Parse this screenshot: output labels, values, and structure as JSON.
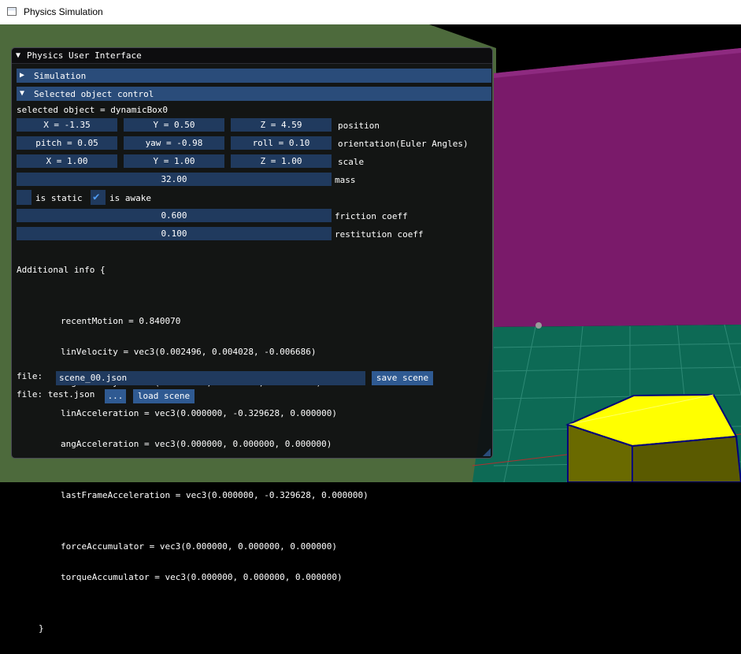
{
  "window": {
    "title": "Physics Simulation"
  },
  "panel": {
    "title": "Physics User Interface",
    "sections": {
      "simulation": "Simulation",
      "selected": "Selected object control"
    },
    "selected_object": "selected object = dynamicBox0",
    "position": {
      "x": "X = -1.35",
      "y": "Y = 0.50",
      "z": "Z = 4.59",
      "label": "position"
    },
    "orientation": {
      "pitch": "pitch = 0.05",
      "yaw": "yaw = -0.98",
      "roll": "roll = 0.10",
      "label": "orientation(Euler Angles)"
    },
    "scale": {
      "x": "X = 1.00",
      "y": "Y = 1.00",
      "z": "Z = 1.00",
      "label": "scale"
    },
    "mass": {
      "value": "32.00",
      "label": "mass"
    },
    "flags": {
      "is_static_label": "is static",
      "is_static": false,
      "is_awake_label": "is awake",
      "is_awake": true
    },
    "friction": {
      "value": "0.600",
      "label": "friction coeff"
    },
    "restitution": {
      "value": "0.100",
      "label": "restitution coeff"
    },
    "additional_info": {
      "header": "Additional info {",
      "lines": [
        "recentMotion = 0.840070",
        "linVelocity = vec3(0.002496, 0.004028, -0.006686)",
        "angVelocity = vec3(-0.017823, 0.007141, -0.024257)",
        "linAcceleration = vec3(0.000000, -0.329628, 0.000000)",
        "angAcceleration = vec3(0.000000, 0.000000, 0.000000)",
        "",
        "lastFrameAcceleration = vec3(0.000000, -0.329628, 0.000000)",
        "",
        "forceAccumulator = vec3(0.000000, 0.000000, 0.000000)",
        "torqueAccumulator = vec3(0.000000, 0.000000, 0.000000)"
      ],
      "footer": "}"
    },
    "save": {
      "label": "file:",
      "filename": "scene_00.json",
      "button": "save scene"
    },
    "load": {
      "label": "file: test.json",
      "browse": "...",
      "button": "load scene"
    }
  },
  "colors": {
    "header": "#2a4c7a",
    "cell": "#203a5e",
    "button": "#2f5a92",
    "wall": "#7a1a6a",
    "floor": "#0d6a55",
    "box_top": "#ffff00",
    "box_side": "#6a6a00"
  },
  "icons": {
    "collapsed": "triangle-right-icon",
    "expanded": "triangle-down-icon",
    "check": "checkmark-icon"
  }
}
